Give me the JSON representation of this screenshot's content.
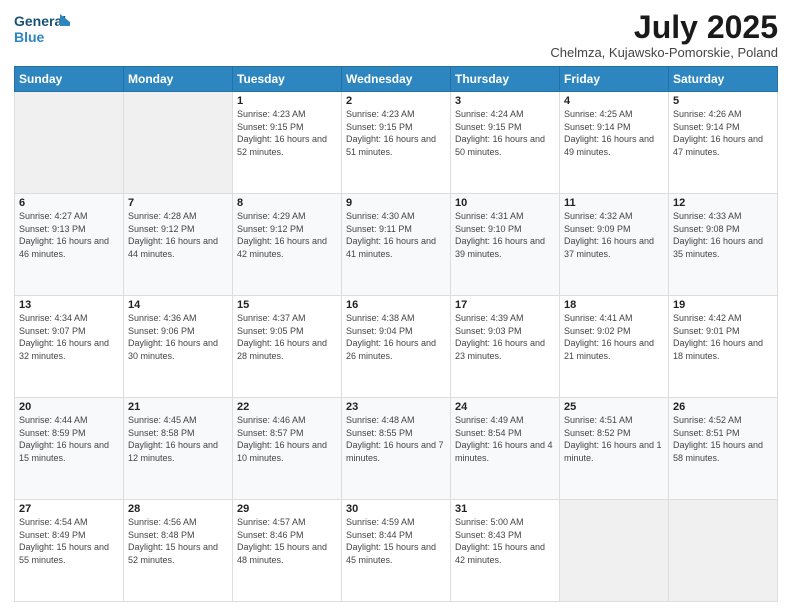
{
  "logo": {
    "line1": "General",
    "line2": "Blue"
  },
  "title": "July 2025",
  "subtitle": "Chelmza, Kujawsko-Pomorskie, Poland",
  "weekdays": [
    "Sunday",
    "Monday",
    "Tuesday",
    "Wednesday",
    "Thursday",
    "Friday",
    "Saturday"
  ],
  "weeks": [
    [
      {
        "day": "",
        "info": ""
      },
      {
        "day": "",
        "info": ""
      },
      {
        "day": "1",
        "info": "Sunrise: 4:23 AM\nSunset: 9:15 PM\nDaylight: 16 hours and 52 minutes."
      },
      {
        "day": "2",
        "info": "Sunrise: 4:23 AM\nSunset: 9:15 PM\nDaylight: 16 hours and 51 minutes."
      },
      {
        "day": "3",
        "info": "Sunrise: 4:24 AM\nSunset: 9:15 PM\nDaylight: 16 hours and 50 minutes."
      },
      {
        "day": "4",
        "info": "Sunrise: 4:25 AM\nSunset: 9:14 PM\nDaylight: 16 hours and 49 minutes."
      },
      {
        "day": "5",
        "info": "Sunrise: 4:26 AM\nSunset: 9:14 PM\nDaylight: 16 hours and 47 minutes."
      }
    ],
    [
      {
        "day": "6",
        "info": "Sunrise: 4:27 AM\nSunset: 9:13 PM\nDaylight: 16 hours and 46 minutes."
      },
      {
        "day": "7",
        "info": "Sunrise: 4:28 AM\nSunset: 9:12 PM\nDaylight: 16 hours and 44 minutes."
      },
      {
        "day": "8",
        "info": "Sunrise: 4:29 AM\nSunset: 9:12 PM\nDaylight: 16 hours and 42 minutes."
      },
      {
        "day": "9",
        "info": "Sunrise: 4:30 AM\nSunset: 9:11 PM\nDaylight: 16 hours and 41 minutes."
      },
      {
        "day": "10",
        "info": "Sunrise: 4:31 AM\nSunset: 9:10 PM\nDaylight: 16 hours and 39 minutes."
      },
      {
        "day": "11",
        "info": "Sunrise: 4:32 AM\nSunset: 9:09 PM\nDaylight: 16 hours and 37 minutes."
      },
      {
        "day": "12",
        "info": "Sunrise: 4:33 AM\nSunset: 9:08 PM\nDaylight: 16 hours and 35 minutes."
      }
    ],
    [
      {
        "day": "13",
        "info": "Sunrise: 4:34 AM\nSunset: 9:07 PM\nDaylight: 16 hours and 32 minutes."
      },
      {
        "day": "14",
        "info": "Sunrise: 4:36 AM\nSunset: 9:06 PM\nDaylight: 16 hours and 30 minutes."
      },
      {
        "day": "15",
        "info": "Sunrise: 4:37 AM\nSunset: 9:05 PM\nDaylight: 16 hours and 28 minutes."
      },
      {
        "day": "16",
        "info": "Sunrise: 4:38 AM\nSunset: 9:04 PM\nDaylight: 16 hours and 26 minutes."
      },
      {
        "day": "17",
        "info": "Sunrise: 4:39 AM\nSunset: 9:03 PM\nDaylight: 16 hours and 23 minutes."
      },
      {
        "day": "18",
        "info": "Sunrise: 4:41 AM\nSunset: 9:02 PM\nDaylight: 16 hours and 21 minutes."
      },
      {
        "day": "19",
        "info": "Sunrise: 4:42 AM\nSunset: 9:01 PM\nDaylight: 16 hours and 18 minutes."
      }
    ],
    [
      {
        "day": "20",
        "info": "Sunrise: 4:44 AM\nSunset: 8:59 PM\nDaylight: 16 hours and 15 minutes."
      },
      {
        "day": "21",
        "info": "Sunrise: 4:45 AM\nSunset: 8:58 PM\nDaylight: 16 hours and 12 minutes."
      },
      {
        "day": "22",
        "info": "Sunrise: 4:46 AM\nSunset: 8:57 PM\nDaylight: 16 hours and 10 minutes."
      },
      {
        "day": "23",
        "info": "Sunrise: 4:48 AM\nSunset: 8:55 PM\nDaylight: 16 hours and 7 minutes."
      },
      {
        "day": "24",
        "info": "Sunrise: 4:49 AM\nSunset: 8:54 PM\nDaylight: 16 hours and 4 minutes."
      },
      {
        "day": "25",
        "info": "Sunrise: 4:51 AM\nSunset: 8:52 PM\nDaylight: 16 hours and 1 minute."
      },
      {
        "day": "26",
        "info": "Sunrise: 4:52 AM\nSunset: 8:51 PM\nDaylight: 15 hours and 58 minutes."
      }
    ],
    [
      {
        "day": "27",
        "info": "Sunrise: 4:54 AM\nSunset: 8:49 PM\nDaylight: 15 hours and 55 minutes."
      },
      {
        "day": "28",
        "info": "Sunrise: 4:56 AM\nSunset: 8:48 PM\nDaylight: 15 hours and 52 minutes."
      },
      {
        "day": "29",
        "info": "Sunrise: 4:57 AM\nSunset: 8:46 PM\nDaylight: 15 hours and 48 minutes."
      },
      {
        "day": "30",
        "info": "Sunrise: 4:59 AM\nSunset: 8:44 PM\nDaylight: 15 hours and 45 minutes."
      },
      {
        "day": "31",
        "info": "Sunrise: 5:00 AM\nSunset: 8:43 PM\nDaylight: 15 hours and 42 minutes."
      },
      {
        "day": "",
        "info": ""
      },
      {
        "day": "",
        "info": ""
      }
    ]
  ]
}
